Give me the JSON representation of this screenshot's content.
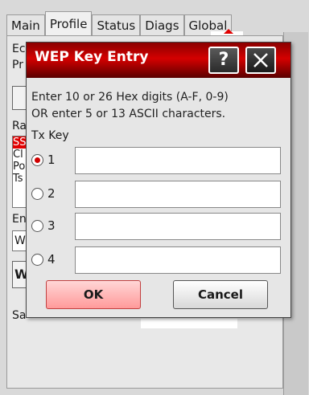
{
  "app": {
    "tabs": [
      {
        "label": "Main"
      },
      {
        "label": "Profile"
      },
      {
        "label": "Status"
      },
      {
        "label": "Diags"
      },
      {
        "label": "Global"
      }
    ],
    "active_tab": "Profile",
    "bg_labels": [
      "Ec",
      "Pr",
      "Ra",
      "En",
      "Sa"
    ],
    "bg_list_items": [
      "SS",
      "Cl",
      "Po",
      "Ts"
    ],
    "bg_field_value": "W",
    "bg_button_label": "W"
  },
  "dialog": {
    "title": "WEP Key Entry",
    "help_label": "?",
    "instructions": [
      "Enter 10 or 26 Hex digits (A-F, 0-9)",
      "OR enter 5 or 13 ASCII characters."
    ],
    "tx_key_label": "Tx Key",
    "keys": [
      {
        "label": "1",
        "value": "",
        "selected": true
      },
      {
        "label": "2",
        "value": "",
        "selected": false
      },
      {
        "label": "3",
        "value": "",
        "selected": false
      },
      {
        "label": "4",
        "value": "",
        "selected": false
      }
    ],
    "ok_label": "OK",
    "cancel_label": "Cancel"
  },
  "colors": {
    "title_bar": "#c00000",
    "selection": "#e00000",
    "ok_button": "#ffb0b0"
  }
}
